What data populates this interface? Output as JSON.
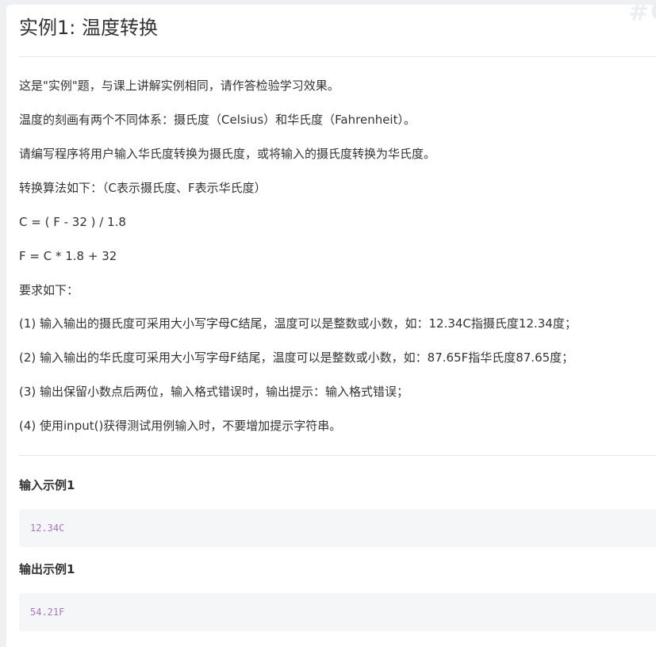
{
  "problem": {
    "title": "实例1: 温度转换",
    "paragraphs": [
      "这是\"实例\"题，与课上讲解实例相同，请作答检验学习效果。",
      "温度的刻画有两个不同体系：摄氏度（Celsius）和华氏度（Fahrenheit）。",
      "请编写程序将用户输入华氏度转换为摄氏度，或将输入的摄氏度转换为华氏度。",
      "转换算法如下：（C表示摄氏度、F表示华氏度）",
      "C = ( F - 32 ) / 1.8",
      "F = C * 1.8 + 32",
      "要求如下：",
      "(1) 输入输出的摄氏度可采用大小写字母C结尾，温度可以是整数或小数，如：12.34C指摄氏度12.34度；",
      "(2) 输入输出的华氏度可采用大小写字母F结尾，温度可以是整数或小数，如：87.65F指华氏度87.65度；",
      "(3) 输出保留小数点后两位，输入格式错误时，输出提示：输入格式错误；",
      "(4) 使用input()获得测试用例输入时，不要增加提示字符串。"
    ]
  },
  "examples": {
    "input_title": "输入示例1",
    "input_value": "12.34C",
    "output_title": "输出示例1",
    "output_value": "54.21F"
  },
  "watermark": "#C",
  "colors": {
    "code_text": "#a776c0",
    "code_bg": "#f5f6f8",
    "text": "#333333"
  }
}
